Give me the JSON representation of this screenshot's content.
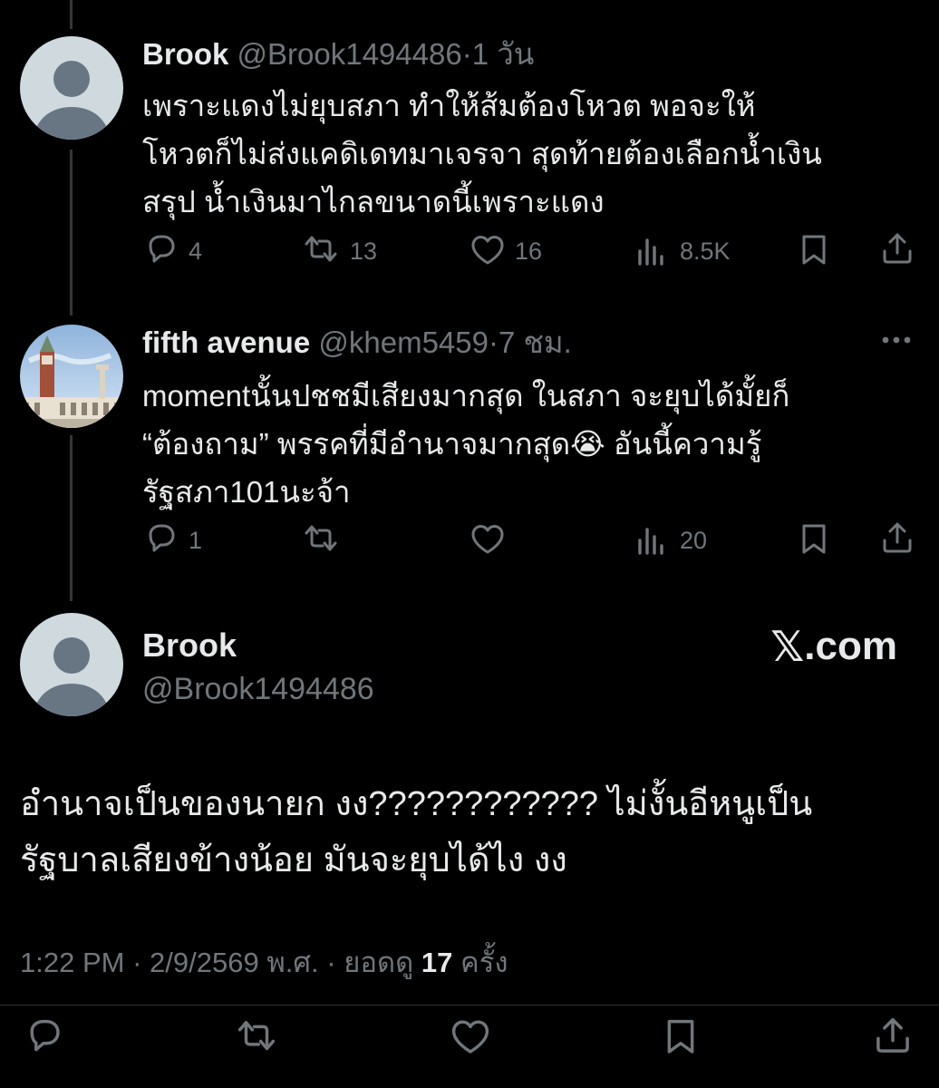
{
  "replies": [
    {
      "name": "Brook",
      "handle": "@Brook1494486",
      "separator": "·",
      "time": "1 วัน",
      "lines": [
        "เพราะแดงไม่ยุบสภา ทำให้ส้มต้องโหวต พอจะให้",
        "โหวตก็ไม่ส่งแคดิเดทมาเจรจา สุดท้ายต้องเลือกน้ำเงิน",
        "สรุป น้ำเงินมาไกลขนาดนี้เพราะแดง"
      ],
      "reply_count": "4",
      "repost_count": "13",
      "like_count": "16",
      "view_count": "8.5K"
    },
    {
      "name": "fifth avenue",
      "handle": "@khem5459",
      "separator": "·",
      "time": "7 ชม.",
      "lines": [
        "momentนั้นปชชมีเสียงมากสุด ในสภา จะยุบได้มั้ยก็",
        "“ต้องถาม” พรรคที่มีอำนาจมากสุด😭  อันนี้ความรู้",
        "รัฐสภา101นะจ้า"
      ],
      "reply_count": "1",
      "repost_count": "",
      "like_count": "",
      "view_count": "20"
    }
  ],
  "main_post": {
    "name": "Brook",
    "handle": "@Brook1494486",
    "brand_mark": "𝕏",
    "brand_text": ".com",
    "lines": [
      "อำนาจเป็นของนายก งง????????????  ไม่งั้นอีหนูเป็น",
      "รัฐบาลเสียงข้างน้อย มันจะยุบได้ไง งง"
    ],
    "time": "1:22 PM",
    "separator": "·",
    "date": "2/9/2569 พ.ศ.",
    "views_label": "ยอดดู",
    "views_count": "17",
    "views_suffix": "ครั้ง"
  },
  "icons": {
    "reply": "reply-icon",
    "repost": "repost-icon",
    "like": "heart-icon",
    "views": "views-icon",
    "bookmark": "bookmark-icon",
    "share": "share-icon",
    "more": "more-icon"
  },
  "colors": {
    "background": "#000000",
    "text": "#e7e9ea",
    "muted": "#71767b"
  }
}
